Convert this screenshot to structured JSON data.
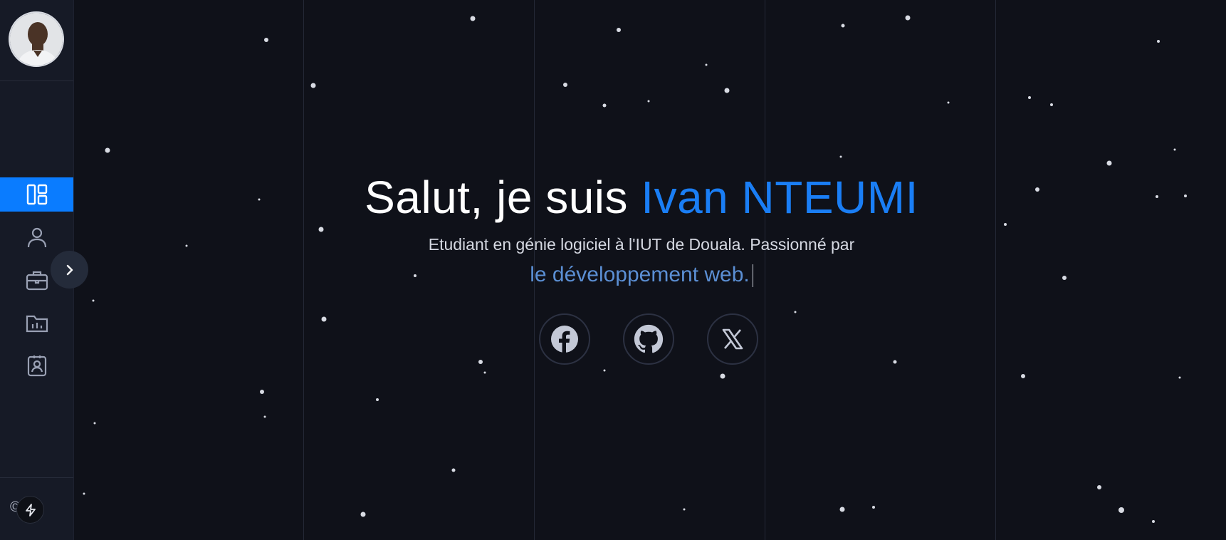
{
  "profile": {
    "avatar_alt": "avatar"
  },
  "nav": {
    "items": [
      {
        "id": "dashboard",
        "icon": "dashboard-icon",
        "active": true
      },
      {
        "id": "about",
        "icon": "user-icon",
        "active": false
      },
      {
        "id": "experience",
        "icon": "briefcase-icon",
        "active": false
      },
      {
        "id": "projects",
        "icon": "folder-chart-icon",
        "active": false
      },
      {
        "id": "contact",
        "icon": "contact-card-icon",
        "active": false
      }
    ],
    "toggle_icon": "chevron-right-icon"
  },
  "footer": {
    "copyright": "©  25"
  },
  "hero": {
    "greeting": "Salut, je suis",
    "name": "Ivan NTEUMI",
    "subtitle": "Etudiant en génie logiciel à l'IUT de Douala. Passionné par",
    "typed": "le développement web."
  },
  "social": [
    {
      "name": "facebook",
      "icon": "facebook-icon"
    },
    {
      "name": "github",
      "icon": "github-icon"
    },
    {
      "name": "x",
      "icon": "x-icon"
    }
  ],
  "colors": {
    "accent": "#1a7ef5",
    "background": "#0f1119",
    "sidebar": "#161a26"
  }
}
